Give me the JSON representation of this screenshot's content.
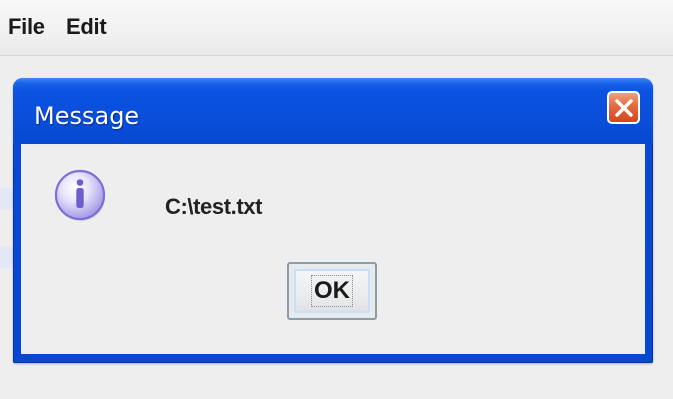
{
  "menubar": {
    "items": [
      {
        "label": "File"
      },
      {
        "label": "Edit"
      }
    ]
  },
  "dialog": {
    "title": "Message",
    "close_icon": "close-icon",
    "info_icon": "info-icon",
    "message": "C:\\test.txt",
    "ok_label": "OK"
  },
  "colors": {
    "titlebar_blue": "#0a52e0",
    "close_red": "#e46a3f",
    "window_bg": "#eeeeee",
    "info_purple": "#7b6fd6"
  }
}
